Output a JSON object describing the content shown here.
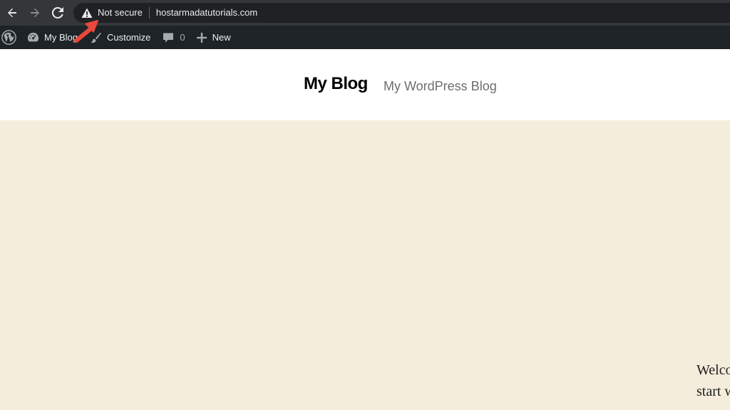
{
  "browser": {
    "security_label": "Not secure",
    "url": "hostarmadatutorials.com"
  },
  "admin_bar": {
    "site_name": "My Blog",
    "customize_label": "Customize",
    "comments_count": "0",
    "new_label": "New"
  },
  "site": {
    "title": "My Blog",
    "tagline": "My WordPress Blog"
  },
  "content": {
    "line1": "Welco",
    "line2": "start w"
  },
  "colors": {
    "annotation_arrow": "#e8483d",
    "content_background": "#f5eddc",
    "admin_bar": "#1d2327"
  }
}
